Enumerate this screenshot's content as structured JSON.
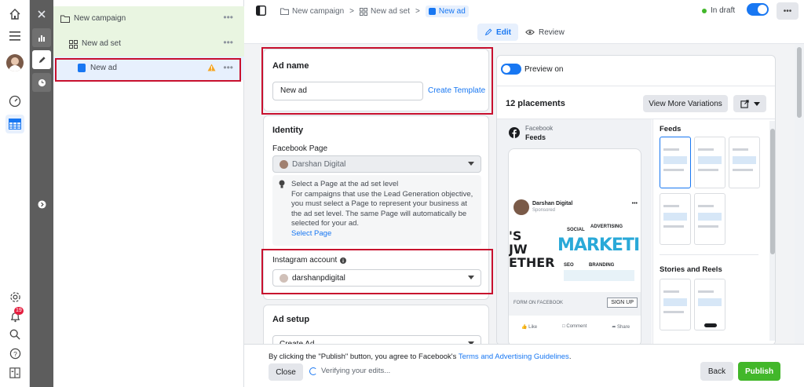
{
  "tree": {
    "campaign": "New campaign",
    "adset": "New ad set",
    "ad": "New ad"
  },
  "breadcrumb": {
    "campaign": "New campaign",
    "adset": "New ad set",
    "ad": "New ad"
  },
  "status": {
    "label": "In draft"
  },
  "modes": {
    "edit": "Edit",
    "review": "Review"
  },
  "ad_name": {
    "heading": "Ad name",
    "value": "New ad",
    "template_link": "Create Template"
  },
  "identity": {
    "heading": "Identity",
    "fb_label": "Facebook Page",
    "fb_value": "Darshan Digital",
    "info_title": "Select a Page at the ad set level",
    "info_body": "For campaigns that use the Lead Generation objective, you must select a Page to represent your business at the ad set level. The same Page will automatically be selected for your ad.",
    "info_link": "Select Page",
    "ig_label": "Instagram account",
    "ig_value": "darshanpdigital"
  },
  "ad_setup": {
    "heading": "Ad setup",
    "value": "Create Ad"
  },
  "preview": {
    "toggle_label": "Preview on",
    "placements": "12 placements",
    "variations_button": "View More Variations",
    "platform": "Facebook",
    "placement_name": "Feeds",
    "page_name": "Darshan Digital",
    "sponsored": "Sponsored",
    "post_big_left": [
      "'S",
      "JW",
      "ETHER"
    ],
    "post_brand": "MARKETIN",
    "post_words": {
      "social": "SOCIAL",
      "advertising": "ADVERTISING",
      "seo": "SEO",
      "branding": "BRANDING"
    },
    "cta_caption": "FORM ON FACEBOOK",
    "cta_button": "SIGN UP",
    "actions": {
      "like": "Like",
      "comment": "Comment",
      "share": "Share"
    },
    "side_feeds": "Feeds",
    "side_stories": "Stories and Reels"
  },
  "footer": {
    "notice_prefix": "By clicking the \"Publish\" button, you agree to Facebook's ",
    "notice_link": "Terms and Advertising Guidelines",
    "notice_suffix": ".",
    "close": "Close",
    "verifying": "Verifying your edits...",
    "back": "Back",
    "publish": "Publish"
  },
  "rail": {
    "notification_count": "19"
  },
  "colors": {
    "accent": "#1877f2",
    "publish": "#42b72a",
    "highlight": "#c8102e",
    "draft_dot": "#42b72a"
  }
}
